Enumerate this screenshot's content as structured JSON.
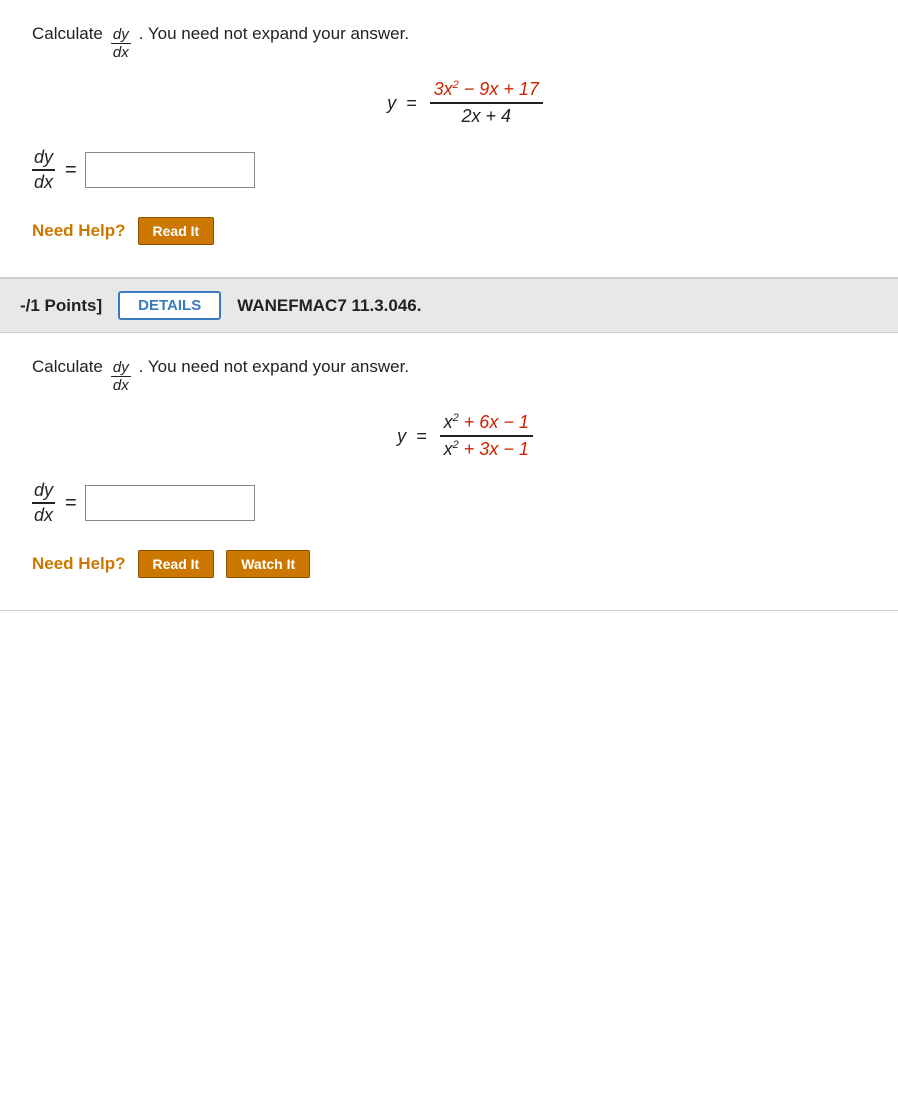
{
  "section1": {
    "instruction_prefix": "Calculate",
    "dy": "dy",
    "dx": "dx",
    "instruction_suffix": ". You need not expand your answer.",
    "equation_lhs": "y =",
    "numerator": "3x² − 9x + 17",
    "denominator": "2x + 4",
    "answer_label_dy": "dy",
    "answer_label_dx": "dx",
    "equals": "=",
    "need_help": "Need Help?",
    "btn_read": "Read It"
  },
  "section2": {
    "points_label": "-/1 Points]",
    "details_btn": "DETAILS",
    "section_id": "WANEFMAC7 11.3.046.",
    "instruction_prefix": "Calculate",
    "dy": "dy",
    "dx": "dx",
    "instruction_suffix": ". You need not expand your answer.",
    "equation_lhs": "y =",
    "numerator": "x² + 6x − 1",
    "denominator": "x² + 3x − 1",
    "answer_label_dy": "dy",
    "answer_label_dx": "dx",
    "equals": "=",
    "need_help": "Need Help?",
    "btn_read": "Read It",
    "btn_watch": "Watch It"
  }
}
